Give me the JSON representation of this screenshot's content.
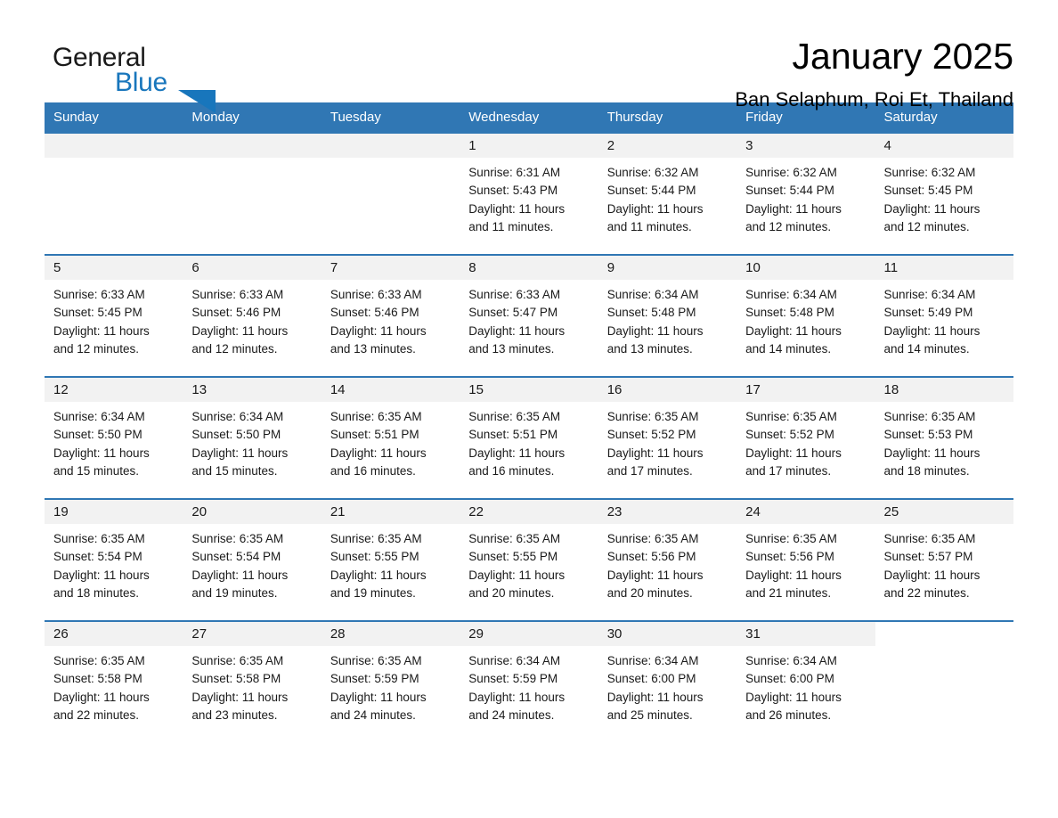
{
  "brand": {
    "name_dark": "General",
    "name_blue": "Blue",
    "triangle_color": "#1876bc",
    "blue_color": "#1876bc"
  },
  "header": {
    "title": "January 2025",
    "location": "Ban Selaphum, Roi Et, Thailand"
  },
  "theme": {
    "header_row_bg": "#3077b4",
    "header_row_text": "#ffffff",
    "daynum_band_bg": "#f2f2f2",
    "cell_divider": "#3077b4",
    "body_text": "#1a1a1a"
  },
  "weekday_headers": [
    "Sunday",
    "Monday",
    "Tuesday",
    "Wednesday",
    "Thursday",
    "Friday",
    "Saturday"
  ],
  "weeks": [
    [
      {
        "day": "",
        "sunrise": "",
        "sunset": "",
        "daylight_line1": "",
        "daylight_line2": "",
        "empty": true
      },
      {
        "day": "",
        "sunrise": "",
        "sunset": "",
        "daylight_line1": "",
        "daylight_line2": "",
        "empty": true
      },
      {
        "day": "",
        "sunrise": "",
        "sunset": "",
        "daylight_line1": "",
        "daylight_line2": "",
        "empty": true
      },
      {
        "day": "1",
        "sunrise": "Sunrise: 6:31 AM",
        "sunset": "Sunset: 5:43 PM",
        "daylight_line1": "Daylight: 11 hours",
        "daylight_line2": "and 11 minutes.",
        "empty": false
      },
      {
        "day": "2",
        "sunrise": "Sunrise: 6:32 AM",
        "sunset": "Sunset: 5:44 PM",
        "daylight_line1": "Daylight: 11 hours",
        "daylight_line2": "and 11 minutes.",
        "empty": false
      },
      {
        "day": "3",
        "sunrise": "Sunrise: 6:32 AM",
        "sunset": "Sunset: 5:44 PM",
        "daylight_line1": "Daylight: 11 hours",
        "daylight_line2": "and 12 minutes.",
        "empty": false
      },
      {
        "day": "4",
        "sunrise": "Sunrise: 6:32 AM",
        "sunset": "Sunset: 5:45 PM",
        "daylight_line1": "Daylight: 11 hours",
        "daylight_line2": "and 12 minutes.",
        "empty": false
      }
    ],
    [
      {
        "day": "5",
        "sunrise": "Sunrise: 6:33 AM",
        "sunset": "Sunset: 5:45 PM",
        "daylight_line1": "Daylight: 11 hours",
        "daylight_line2": "and 12 minutes.",
        "empty": false
      },
      {
        "day": "6",
        "sunrise": "Sunrise: 6:33 AM",
        "sunset": "Sunset: 5:46 PM",
        "daylight_line1": "Daylight: 11 hours",
        "daylight_line2": "and 12 minutes.",
        "empty": false
      },
      {
        "day": "7",
        "sunrise": "Sunrise: 6:33 AM",
        "sunset": "Sunset: 5:46 PM",
        "daylight_line1": "Daylight: 11 hours",
        "daylight_line2": "and 13 minutes.",
        "empty": false
      },
      {
        "day": "8",
        "sunrise": "Sunrise: 6:33 AM",
        "sunset": "Sunset: 5:47 PM",
        "daylight_line1": "Daylight: 11 hours",
        "daylight_line2": "and 13 minutes.",
        "empty": false
      },
      {
        "day": "9",
        "sunrise": "Sunrise: 6:34 AM",
        "sunset": "Sunset: 5:48 PM",
        "daylight_line1": "Daylight: 11 hours",
        "daylight_line2": "and 13 minutes.",
        "empty": false
      },
      {
        "day": "10",
        "sunrise": "Sunrise: 6:34 AM",
        "sunset": "Sunset: 5:48 PM",
        "daylight_line1": "Daylight: 11 hours",
        "daylight_line2": "and 14 minutes.",
        "empty": false
      },
      {
        "day": "11",
        "sunrise": "Sunrise: 6:34 AM",
        "sunset": "Sunset: 5:49 PM",
        "daylight_line1": "Daylight: 11 hours",
        "daylight_line2": "and 14 minutes.",
        "empty": false
      }
    ],
    [
      {
        "day": "12",
        "sunrise": "Sunrise: 6:34 AM",
        "sunset": "Sunset: 5:50 PM",
        "daylight_line1": "Daylight: 11 hours",
        "daylight_line2": "and 15 minutes.",
        "empty": false
      },
      {
        "day": "13",
        "sunrise": "Sunrise: 6:34 AM",
        "sunset": "Sunset: 5:50 PM",
        "daylight_line1": "Daylight: 11 hours",
        "daylight_line2": "and 15 minutes.",
        "empty": false
      },
      {
        "day": "14",
        "sunrise": "Sunrise: 6:35 AM",
        "sunset": "Sunset: 5:51 PM",
        "daylight_line1": "Daylight: 11 hours",
        "daylight_line2": "and 16 minutes.",
        "empty": false
      },
      {
        "day": "15",
        "sunrise": "Sunrise: 6:35 AM",
        "sunset": "Sunset: 5:51 PM",
        "daylight_line1": "Daylight: 11 hours",
        "daylight_line2": "and 16 minutes.",
        "empty": false
      },
      {
        "day": "16",
        "sunrise": "Sunrise: 6:35 AM",
        "sunset": "Sunset: 5:52 PM",
        "daylight_line1": "Daylight: 11 hours",
        "daylight_line2": "and 17 minutes.",
        "empty": false
      },
      {
        "day": "17",
        "sunrise": "Sunrise: 6:35 AM",
        "sunset": "Sunset: 5:52 PM",
        "daylight_line1": "Daylight: 11 hours",
        "daylight_line2": "and 17 minutes.",
        "empty": false
      },
      {
        "day": "18",
        "sunrise": "Sunrise: 6:35 AM",
        "sunset": "Sunset: 5:53 PM",
        "daylight_line1": "Daylight: 11 hours",
        "daylight_line2": "and 18 minutes.",
        "empty": false
      }
    ],
    [
      {
        "day": "19",
        "sunrise": "Sunrise: 6:35 AM",
        "sunset": "Sunset: 5:54 PM",
        "daylight_line1": "Daylight: 11 hours",
        "daylight_line2": "and 18 minutes.",
        "empty": false
      },
      {
        "day": "20",
        "sunrise": "Sunrise: 6:35 AM",
        "sunset": "Sunset: 5:54 PM",
        "daylight_line1": "Daylight: 11 hours",
        "daylight_line2": "and 19 minutes.",
        "empty": false
      },
      {
        "day": "21",
        "sunrise": "Sunrise: 6:35 AM",
        "sunset": "Sunset: 5:55 PM",
        "daylight_line1": "Daylight: 11 hours",
        "daylight_line2": "and 19 minutes.",
        "empty": false
      },
      {
        "day": "22",
        "sunrise": "Sunrise: 6:35 AM",
        "sunset": "Sunset: 5:55 PM",
        "daylight_line1": "Daylight: 11 hours",
        "daylight_line2": "and 20 minutes.",
        "empty": false
      },
      {
        "day": "23",
        "sunrise": "Sunrise: 6:35 AM",
        "sunset": "Sunset: 5:56 PM",
        "daylight_line1": "Daylight: 11 hours",
        "daylight_line2": "and 20 minutes.",
        "empty": false
      },
      {
        "day": "24",
        "sunrise": "Sunrise: 6:35 AM",
        "sunset": "Sunset: 5:56 PM",
        "daylight_line1": "Daylight: 11 hours",
        "daylight_line2": "and 21 minutes.",
        "empty": false
      },
      {
        "day": "25",
        "sunrise": "Sunrise: 6:35 AM",
        "sunset": "Sunset: 5:57 PM",
        "daylight_line1": "Daylight: 11 hours",
        "daylight_line2": "and 22 minutes.",
        "empty": false
      }
    ],
    [
      {
        "day": "26",
        "sunrise": "Sunrise: 6:35 AM",
        "sunset": "Sunset: 5:58 PM",
        "daylight_line1": "Daylight: 11 hours",
        "daylight_line2": "and 22 minutes.",
        "empty": false
      },
      {
        "day": "27",
        "sunrise": "Sunrise: 6:35 AM",
        "sunset": "Sunset: 5:58 PM",
        "daylight_line1": "Daylight: 11 hours",
        "daylight_line2": "and 23 minutes.",
        "empty": false
      },
      {
        "day": "28",
        "sunrise": "Sunrise: 6:35 AM",
        "sunset": "Sunset: 5:59 PM",
        "daylight_line1": "Daylight: 11 hours",
        "daylight_line2": "and 24 minutes.",
        "empty": false
      },
      {
        "day": "29",
        "sunrise": "Sunrise: 6:34 AM",
        "sunset": "Sunset: 5:59 PM",
        "daylight_line1": "Daylight: 11 hours",
        "daylight_line2": "and 24 minutes.",
        "empty": false
      },
      {
        "day": "30",
        "sunrise": "Sunrise: 6:34 AM",
        "sunset": "Sunset: 6:00 PM",
        "daylight_line1": "Daylight: 11 hours",
        "daylight_line2": "and 25 minutes.",
        "empty": false
      },
      {
        "day": "31",
        "sunrise": "Sunrise: 6:34 AM",
        "sunset": "Sunset: 6:00 PM",
        "daylight_line1": "Daylight: 11 hours",
        "daylight_line2": "and 26 minutes.",
        "empty": false
      },
      {
        "day": "",
        "sunrise": "",
        "sunset": "",
        "daylight_line1": "",
        "daylight_line2": "",
        "empty": true,
        "blank": true
      }
    ]
  ]
}
